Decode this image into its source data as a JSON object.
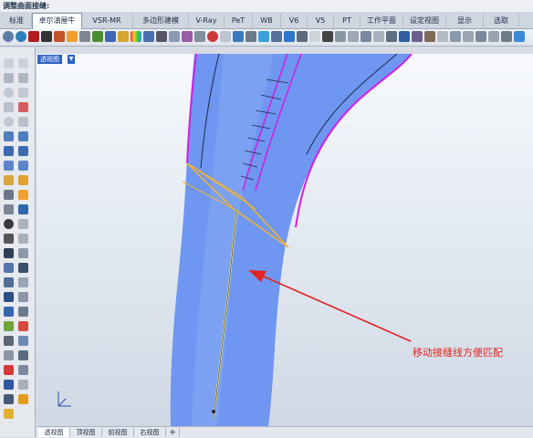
{
  "command_bar": {
    "text": "调整曲面接缝:"
  },
  "tabs": [
    {
      "label": "标准"
    },
    {
      "label": "卓尔滇屋牛"
    },
    {
      "label": "VSR-MR"
    },
    {
      "label": "多边形建模"
    },
    {
      "label": "V-Ray"
    },
    {
      "label": "PeT"
    },
    {
      "label": "WB"
    },
    {
      "label": "V6"
    },
    {
      "label": "V5"
    },
    {
      "label": "PT"
    },
    {
      "label": "工作平面"
    },
    {
      "label": "设定视图"
    },
    {
      "label": "显示"
    },
    {
      "label": "选取"
    }
  ],
  "active_tab": "卓尔滇屋牛",
  "viewport": {
    "label": "透视图",
    "menu_arrow": "▼"
  },
  "bottom_tabs": [
    {
      "label": "透视图"
    },
    {
      "label": "顶视图"
    },
    {
      "label": "前视图"
    },
    {
      "label": "右视图"
    },
    {
      "label": "✣"
    }
  ],
  "annotation": {
    "text": "移动接缝线方便匹配",
    "color": "#e32321"
  },
  "colors": {
    "surface": "#6f96f0",
    "edge_magenta": "#d21fe6",
    "seam": "#e4e38a",
    "highlight": "#f2b233"
  }
}
